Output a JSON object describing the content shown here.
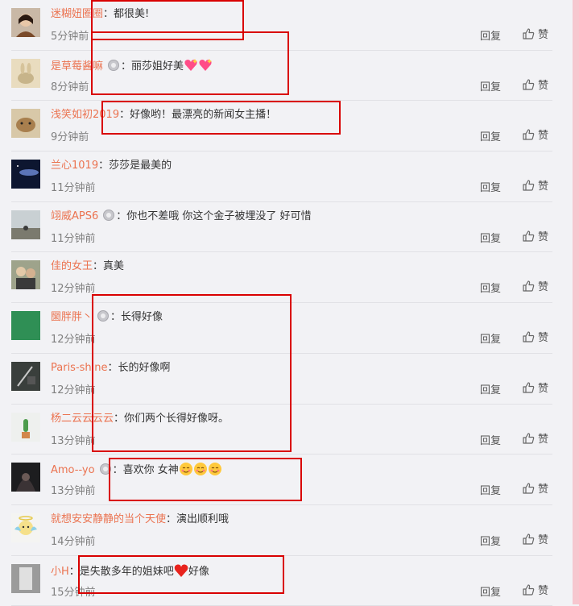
{
  "labels": {
    "reply": "回复",
    "like": "赞",
    "colon": "："
  },
  "colors": {
    "username": "#eb7350",
    "highlight_box": "#d90000",
    "scrollbar": "#f7c6ce"
  },
  "comments": [
    {
      "user": "迷糊妞圈圈",
      "badge": false,
      "text": "都很美!",
      "emojis": [],
      "time": "5分钟前",
      "avatar": "woman-portrait"
    },
    {
      "user": "是草莓酱嘛",
      "badge": true,
      "text": "丽莎姐好美",
      "emojis": [
        "heart-sparkle-emoji",
        "heart-sparkle-emoji"
      ],
      "time": "8分钟前",
      "avatar": "rabbit-photo"
    },
    {
      "user": "浅笑如初2019",
      "badge": false,
      "text": "好像哟！最漂亮的新闻女主播！",
      "emojis": [],
      "time": "9分钟前",
      "avatar": "animal-photo"
    },
    {
      "user": "兰心1019",
      "badge": false,
      "text": "莎莎是最美的",
      "emojis": [],
      "time": "11分钟前",
      "avatar": "night-sky-photo"
    },
    {
      "user": "翊威APS6",
      "badge": true,
      "text": "你也不差哦 你这个金子被埋没了 好可惜",
      "emojis": [],
      "time": "11分钟前",
      "avatar": "landscape-photo"
    },
    {
      "user": "佳的女王",
      "badge": false,
      "text": "真美",
      "emojis": [],
      "time": "12分钟前",
      "avatar": "people-photo"
    },
    {
      "user": "圞胖胖丶",
      "badge": true,
      "text": "长得好像",
      "emojis": [],
      "time": "12分钟前",
      "avatar": "green-square"
    },
    {
      "user": "Paris-shine",
      "badge": false,
      "text": "长的好像啊",
      "emojis": [],
      "time": "12分钟前",
      "avatar": "dark-photo"
    },
    {
      "user": "杨二云云云云",
      "badge": false,
      "text": "你们两个长得好像呀。",
      "emojis": [],
      "time": "13分钟前",
      "avatar": "cactus-photo"
    },
    {
      "user": "Amo--yo",
      "badge": true,
      "text": "喜欢你 女神",
      "emojis": [
        "shy-smile-emoji",
        "shy-smile-emoji",
        "shy-smile-emoji"
      ],
      "time": "13分钟前",
      "avatar": "dark-hair-photo"
    },
    {
      "user": "就想安安静静的当个天使",
      "badge": false,
      "text": "演出顺利哦",
      "emojis": [],
      "time": "14分钟前",
      "avatar": "angel-cartoon"
    },
    {
      "user": "小H",
      "badge": false,
      "text": "是失散多年的姐妹吧",
      "emojis": [
        "red-heart-emoji"
      ],
      "text_after": "好像",
      "time": "15分钟前",
      "avatar": "grey-photo"
    }
  ]
}
